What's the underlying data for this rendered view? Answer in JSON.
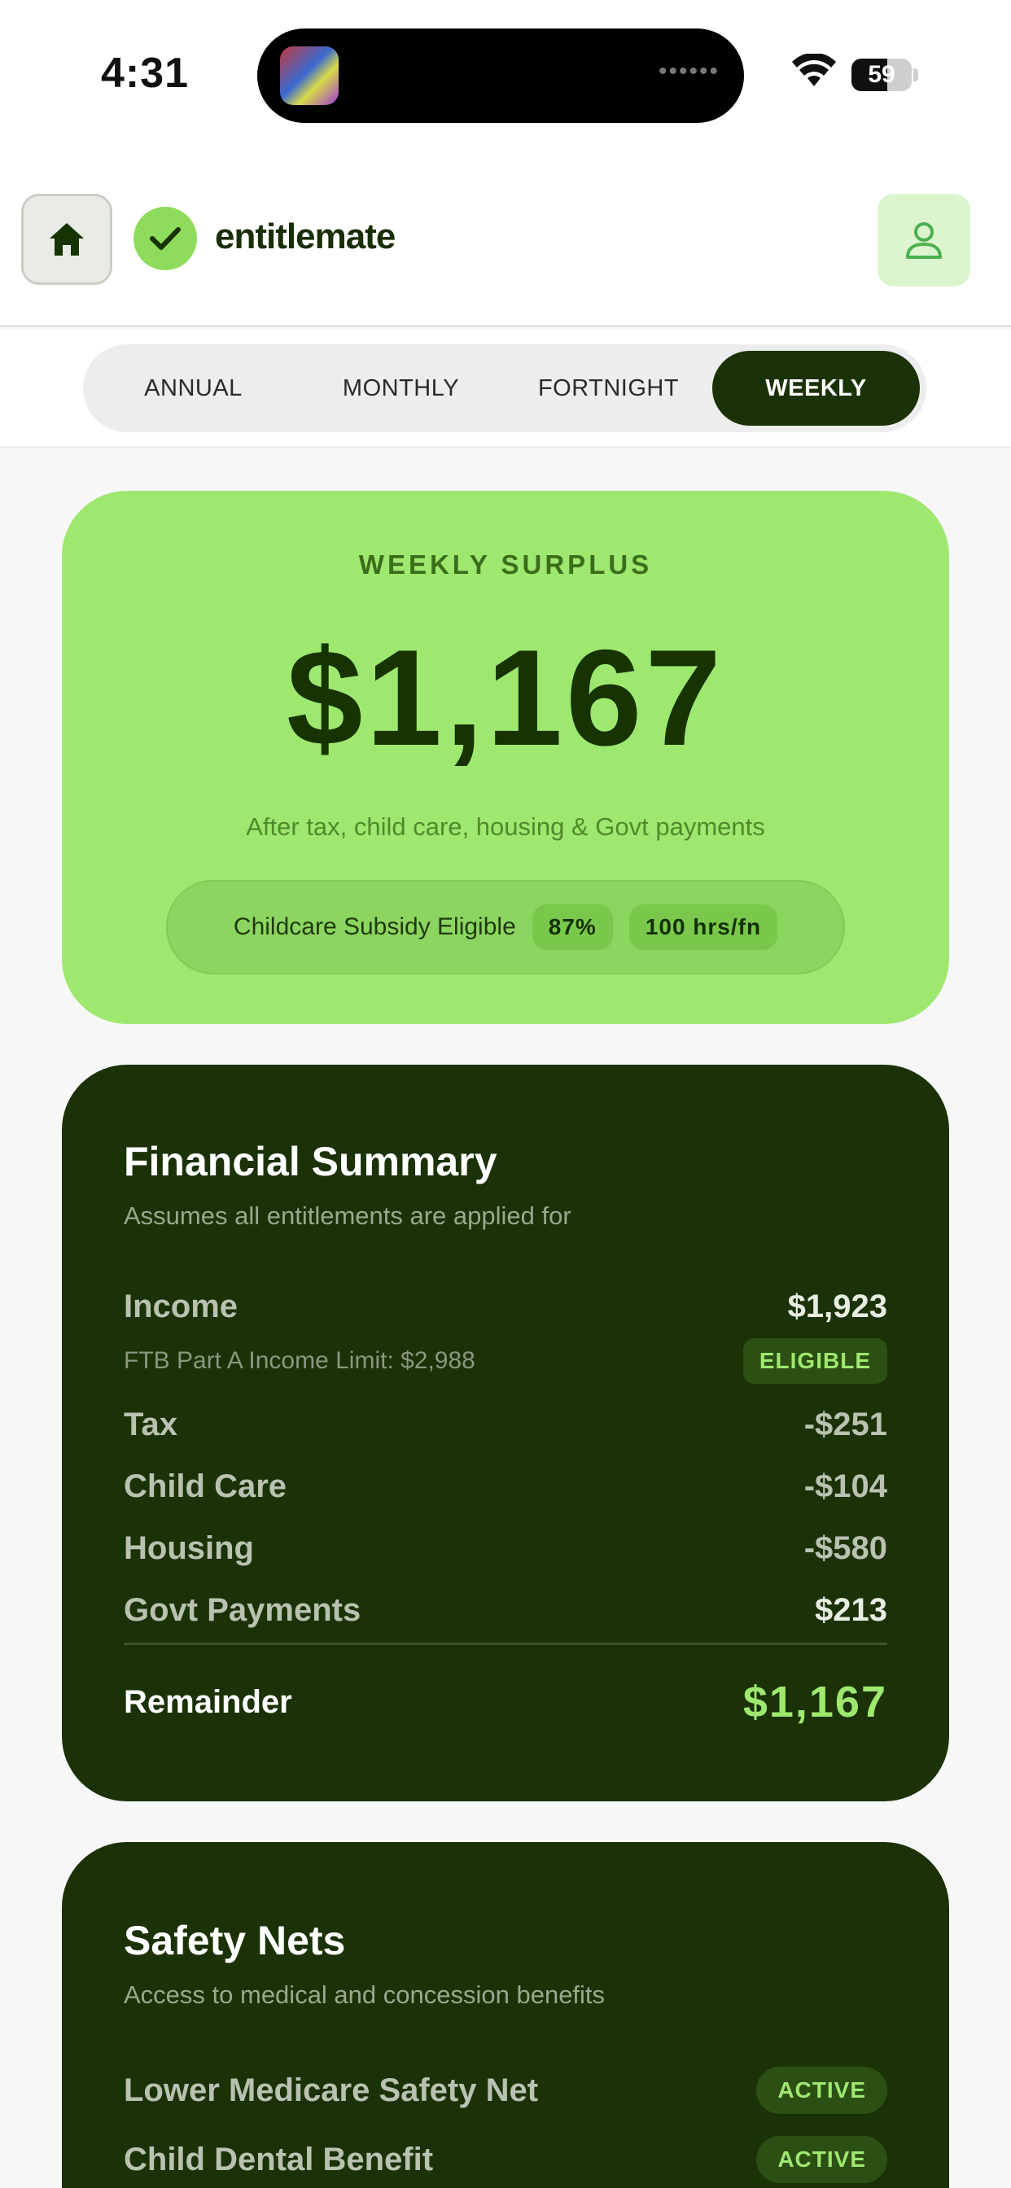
{
  "status_bar": {
    "time": "4:31",
    "battery": "59",
    "battery_level_percent": 59,
    "icons": [
      "app-thumbnail-icon",
      "wifi-icon",
      "battery-icon"
    ]
  },
  "header": {
    "brand": "entitlemate",
    "icons": [
      "home-icon",
      "check-icon",
      "user-icon"
    ]
  },
  "tabs": [
    {
      "label": "ANNUAL",
      "active": false
    },
    {
      "label": "MONTHLY",
      "active": false
    },
    {
      "label": "FORTNIGHT",
      "active": false
    },
    {
      "label": "WEEKLY",
      "active": true
    }
  ],
  "surplus": {
    "title": "WEEKLY SURPLUS",
    "amount": "$1,167",
    "subtitle": "After tax, child care, housing & Govt payments",
    "subsidy_label": "Childcare Subsidy Eligible",
    "subsidy_percent": "87%",
    "subsidy_hours": "100 hrs/fn"
  },
  "summary": {
    "title": "Financial Summary",
    "subtitle": "Assumes all entitlements are applied for",
    "income_label": "Income",
    "income_value": "$1,923",
    "limit_text": "FTB Part A Income Limit: $2,988",
    "eligible_badge": "ELIGIBLE",
    "rows": [
      {
        "label": "Tax",
        "value": "-$251"
      },
      {
        "label": "Child Care",
        "value": "-$104"
      },
      {
        "label": "Housing",
        "value": "-$580"
      },
      {
        "label": "Govt Payments",
        "value": "$213"
      }
    ],
    "remainder_label": "Remainder",
    "remainder_value": "$1,167"
  },
  "safety_nets": {
    "title": "Safety Nets",
    "subtitle": "Access to medical and concession benefits",
    "items": [
      {
        "label": "Lower Medicare Safety Net",
        "status": "ACTIVE"
      },
      {
        "label": "Child Dental Benefit",
        "status": "ACTIVE"
      }
    ]
  },
  "colors": {
    "accent_green": "#9fe870",
    "dark_green": "#1a3205",
    "surface": "#f7f7f8"
  }
}
